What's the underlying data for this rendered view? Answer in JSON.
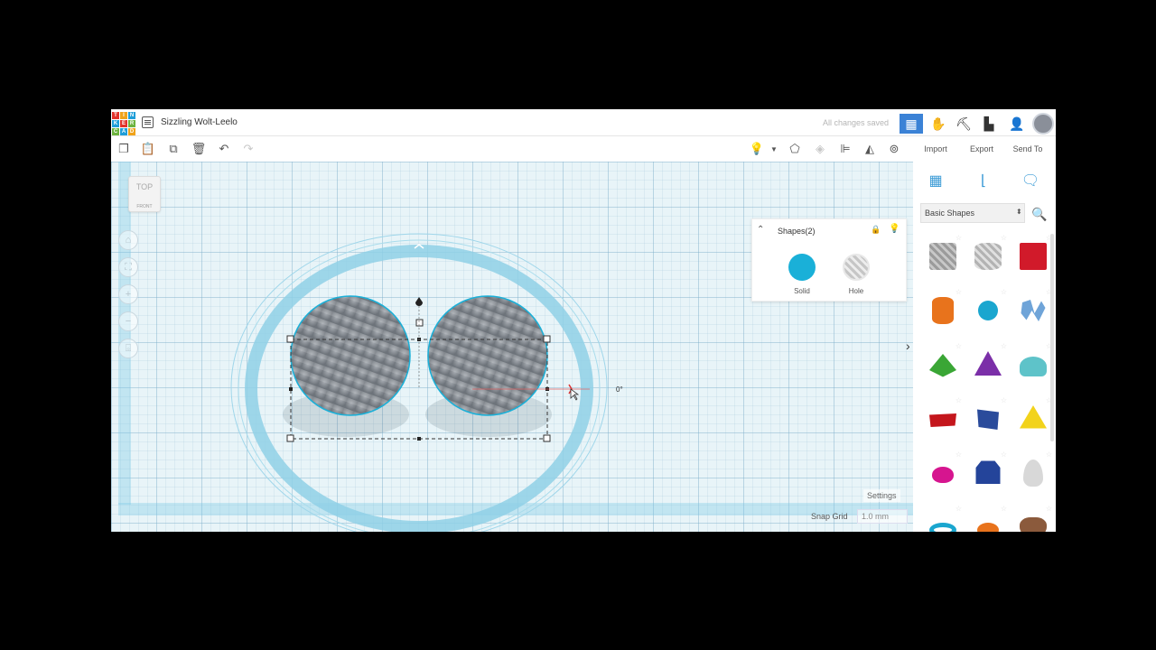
{
  "app": {
    "logo_letters": [
      "T",
      "I",
      "N",
      "K",
      "E",
      "R",
      "C",
      "A",
      "D"
    ],
    "logo_colors": [
      "#e2332b",
      "#f0a31a",
      "#1f9ed8",
      "#1f9ed8",
      "#e2332b",
      "#6db33f",
      "#6db33f",
      "#1f9ed8",
      "#f0a31a"
    ],
    "doc_title": "Sizzling Wolt-Leelo",
    "save_status": "All changes saved",
    "header_icons": [
      "grid-view-icon",
      "hand-icon",
      "pickaxe-icon",
      "bricks-icon",
      "user-add-icon"
    ]
  },
  "toolbar": {
    "tools": [
      "copy-icon",
      "paste-icon",
      "duplicate-icon",
      "delete-icon",
      "undo-icon",
      "redo-icon"
    ],
    "right_tools": [
      "bulb-icon",
      "dropdown-icon",
      "note-icon",
      "group-icon",
      "align-icon",
      "mirror-icon",
      "ungroup-magnet-icon"
    ],
    "import": "Import",
    "export": "Export",
    "send_to": "Send To"
  },
  "workplane": {
    "angle": "0°",
    "settings": "Settings",
    "snap_label": "Snap Grid",
    "snap_value": "1.0 mm",
    "viewcube_top": "TOP",
    "viewcube_front": "FRONT"
  },
  "inspector": {
    "title": "Shapes(2)",
    "solid_label": "Solid",
    "hole_label": "Hole",
    "solid_color": "#1ab0d8"
  },
  "library": {
    "selected": "Basic Shapes",
    "shapes": [
      {
        "name": "box-hole",
        "color": "#9b9b9b"
      },
      {
        "name": "cylinder-hole",
        "color": "#b3b3b3"
      },
      {
        "name": "box",
        "color": "#d11a2a"
      },
      {
        "name": "cylinder",
        "color": "#e8731c"
      },
      {
        "name": "sphere",
        "color": "#1aa6cf"
      },
      {
        "name": "scribble",
        "color": "#6fa4d8"
      },
      {
        "name": "roof",
        "color": "#3aa635"
      },
      {
        "name": "cone",
        "color": "#7b2fa8"
      },
      {
        "name": "round-roof",
        "color": "#5ec3c9"
      },
      {
        "name": "text",
        "color": "#c4161c"
      },
      {
        "name": "half-sphere",
        "color": "#2a4b9b"
      },
      {
        "name": "pyramid",
        "color": "#f2d31b"
      },
      {
        "name": "half-sphere-magenta",
        "color": "#d6158f"
      },
      {
        "name": "polygon",
        "color": "#24449a"
      },
      {
        "name": "paraboloid",
        "color": "#d8d8d8"
      },
      {
        "name": "torus",
        "color": "#1aa6cf"
      },
      {
        "name": "tube",
        "color": "#e8731c"
      },
      {
        "name": "heart",
        "color": "#8b5a3c"
      }
    ]
  }
}
